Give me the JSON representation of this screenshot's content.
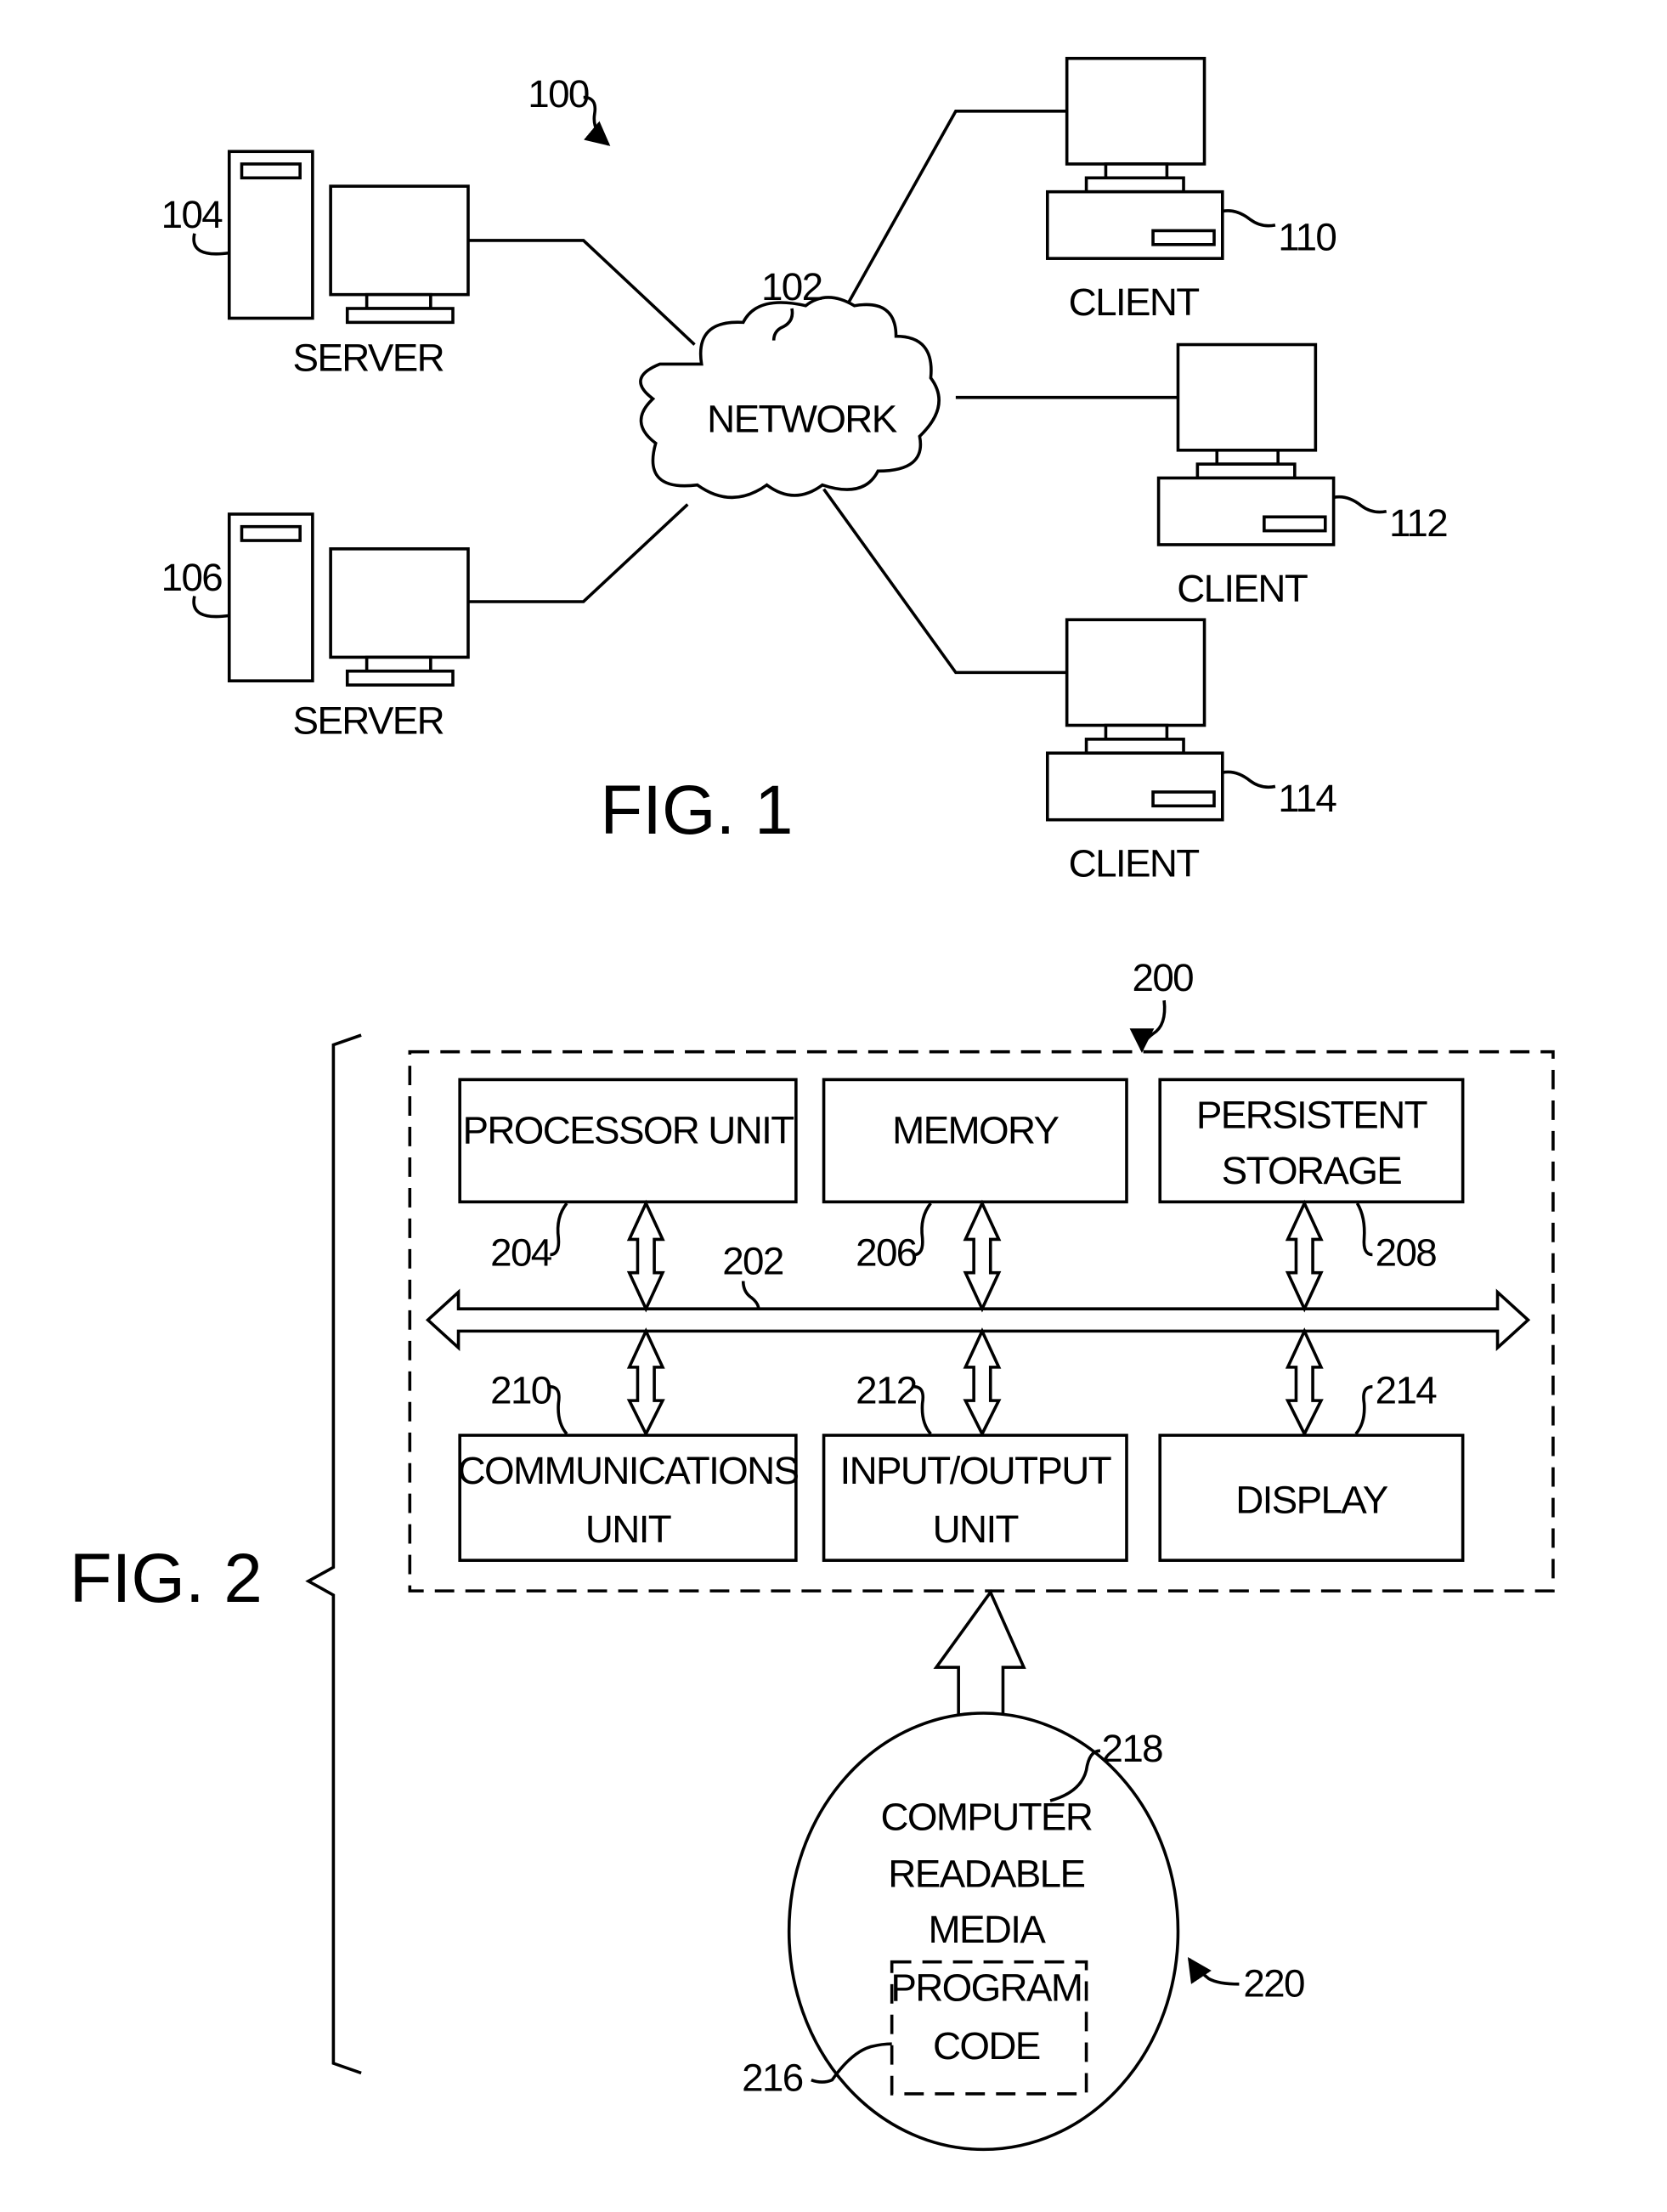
{
  "fig1": {
    "title": "FIG. 1",
    "system_ref": "100",
    "network": {
      "label": "NETWORK",
      "ref": "102"
    },
    "servers": [
      {
        "label": "SERVER",
        "ref": "104"
      },
      {
        "label": "SERVER",
        "ref": "106"
      }
    ],
    "clients": [
      {
        "label": "CLIENT",
        "ref": "110"
      },
      {
        "label": "CLIENT",
        "ref": "112"
      },
      {
        "label": "CLIENT",
        "ref": "114"
      }
    ]
  },
  "fig2": {
    "title": "FIG. 2",
    "system_ref": "200",
    "bus_ref": "202",
    "blocks": [
      {
        "line1": "PROCESSOR UNIT",
        "line2": "",
        "ref": "204"
      },
      {
        "line1": "MEMORY",
        "line2": "",
        "ref": "206"
      },
      {
        "line1": "PERSISTENT",
        "line2": "STORAGE",
        "ref": "208"
      },
      {
        "line1": "COMMUNICATIONS",
        "line2": "UNIT",
        "ref": "210"
      },
      {
        "line1": "INPUT/OUTPUT",
        "line2": "UNIT",
        "ref": "212"
      },
      {
        "line1": "DISPLAY",
        "line2": "",
        "ref": "214"
      }
    ],
    "media": {
      "line1": "COMPUTER",
      "line2": "READABLE",
      "line3": "MEDIA",
      "ref": "218",
      "product_ref": "220",
      "program": {
        "line1": "PROGRAM",
        "line2": "CODE",
        "ref": "216"
      }
    }
  }
}
